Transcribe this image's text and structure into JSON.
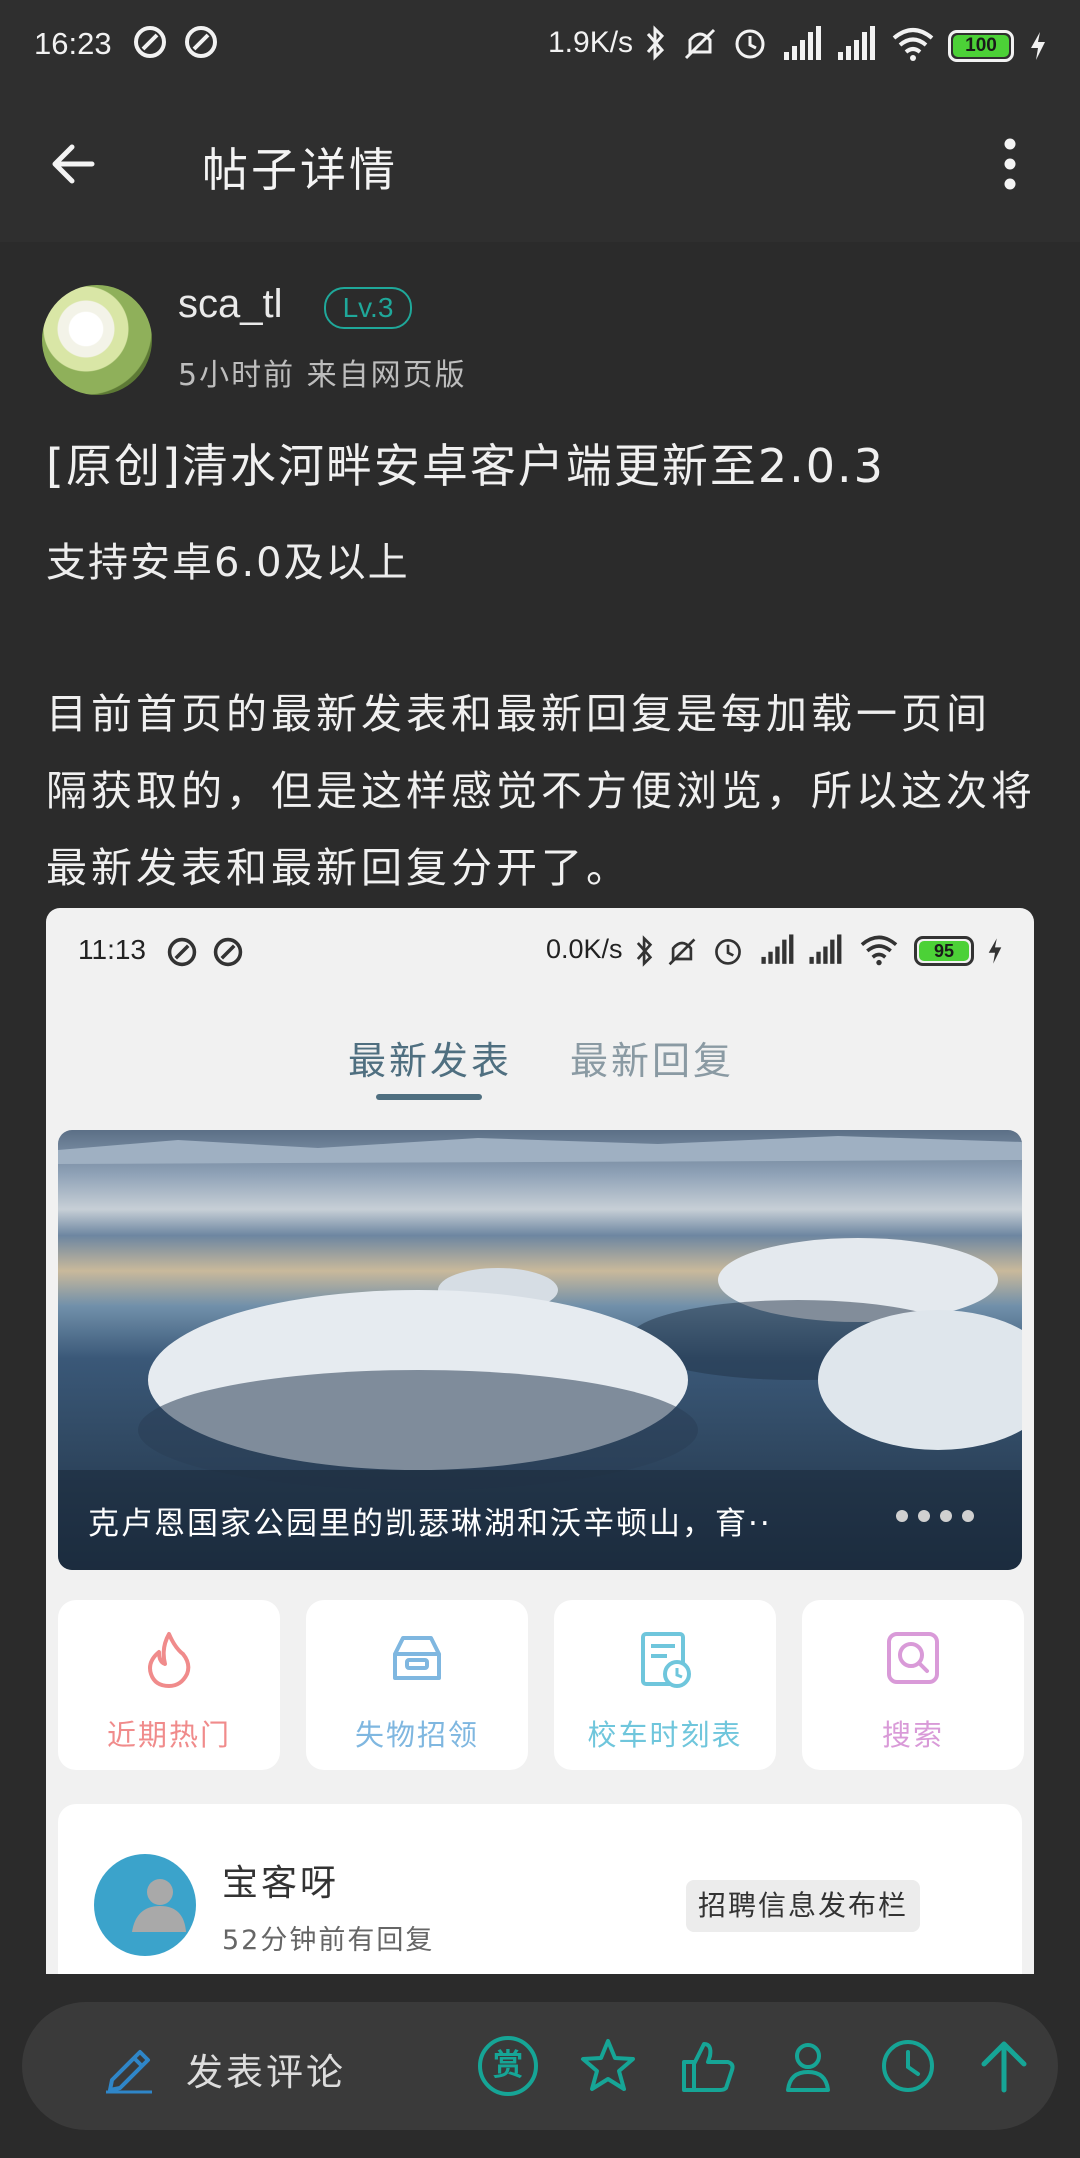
{
  "status_bar": {
    "time": "16:23",
    "net_speed": "1.9K/s",
    "battery": "100"
  },
  "app_bar": {
    "title": "帖子详情"
  },
  "post": {
    "author": "sca_tl",
    "level": "Lv.3",
    "meta": "5小时前 来自网页版",
    "title": "[原创]清水河畔安卓客户端更新至2.0.3",
    "subtitle": "支持安卓6.0及以上",
    "body_lines": [
      "目前首页的最新发表和最新回复是每加载一页间",
      "隔获取的，但是这样感觉不方便浏览，所以这次将",
      "最新发表和最新回复分开了。"
    ]
  },
  "embedded_screenshot": {
    "status_time": "11:13",
    "net_speed": "0.0K/s",
    "battery": "95",
    "tabs": [
      {
        "label": "最新发表",
        "active": true
      },
      {
        "label": "最新回复",
        "active": false
      }
    ],
    "banner_caption": "克卢恩国家公园里的凯瑟琳湖和沃辛顿山，育··",
    "shortcuts": [
      {
        "label": "近期热门",
        "icon": "flame-icon",
        "color": "#f08b8b"
      },
      {
        "label": "失物招领",
        "icon": "box-icon",
        "color": "#7fb7e0"
      },
      {
        "label": "校车时刻表",
        "icon": "schedule-icon",
        "color": "#6fc6dc"
      },
      {
        "label": "搜索",
        "icon": "search-icon",
        "color": "#d99ad8"
      }
    ],
    "reply_card": {
      "name": "宝客呀",
      "time": "52分钟前有回复",
      "tag": "招聘信息发布栏"
    }
  },
  "bottom_bar": {
    "comment_label": "发表评论",
    "accent": "#16a596",
    "icons": [
      "pencil-icon",
      "reward-icon",
      "star-icon",
      "like-icon",
      "person-icon",
      "clock-icon",
      "arrow-up-icon"
    ],
    "reward_glyph": "赏"
  }
}
